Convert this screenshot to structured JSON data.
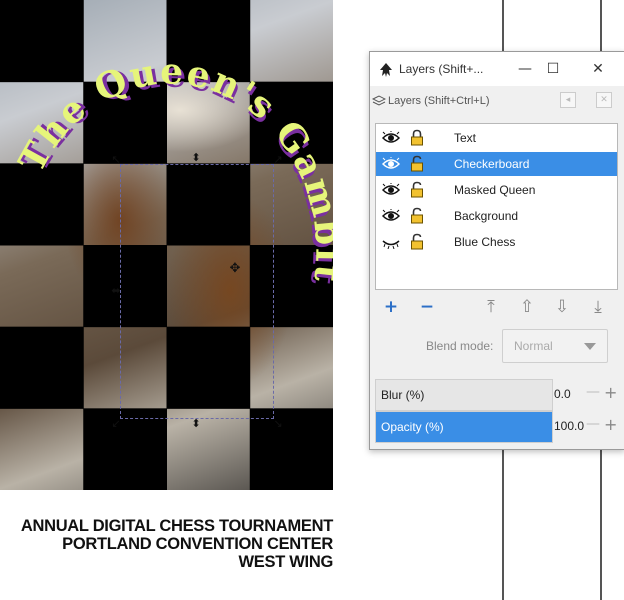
{
  "canvas": {
    "title_text": "The Queen's Gambit",
    "event_lines": [
      "ANNUAL DIGITAL CHESS TOURNAMENT",
      "PORTLAND CONVENTION CENTER",
      "WEST WING"
    ]
  },
  "layers_window": {
    "title": "Layers (Shift+...",
    "panel_title": "Layers (Shift+Ctrl+L)",
    "minimize_glyph": "—",
    "maximize_glyph": "☐",
    "close_glyph": "✕",
    "layers": [
      {
        "name": "Text",
        "visible": true,
        "locked": true,
        "selected": false
      },
      {
        "name": "Checkerboard",
        "visible": true,
        "locked": false,
        "selected": true
      },
      {
        "name": "Masked Queen",
        "visible": true,
        "locked": false,
        "selected": false
      },
      {
        "name": "Background",
        "visible": true,
        "locked": false,
        "selected": false
      },
      {
        "name": "Blue Chess",
        "visible": false,
        "locked": false,
        "selected": false
      }
    ],
    "buttons": {
      "add": "+",
      "remove": "−",
      "raise_to_top": "⤒",
      "raise": "⇧",
      "lower": "⇩",
      "lower_to_bottom": "⤓"
    },
    "blend_mode": {
      "label": "Blend mode:",
      "value": "Normal"
    },
    "blur": {
      "label": "Blur (%)",
      "value": "0.0",
      "percent": 0
    },
    "opacity": {
      "label": "Opacity (%)",
      "value": "100.0",
      "percent": 100
    },
    "stepper": {
      "minus": "—",
      "plus": "+"
    }
  },
  "colors": {
    "accent": "#3a8ee6",
    "title_fill": "#e6f57a",
    "title_shadow": "#7a2fa0"
  }
}
